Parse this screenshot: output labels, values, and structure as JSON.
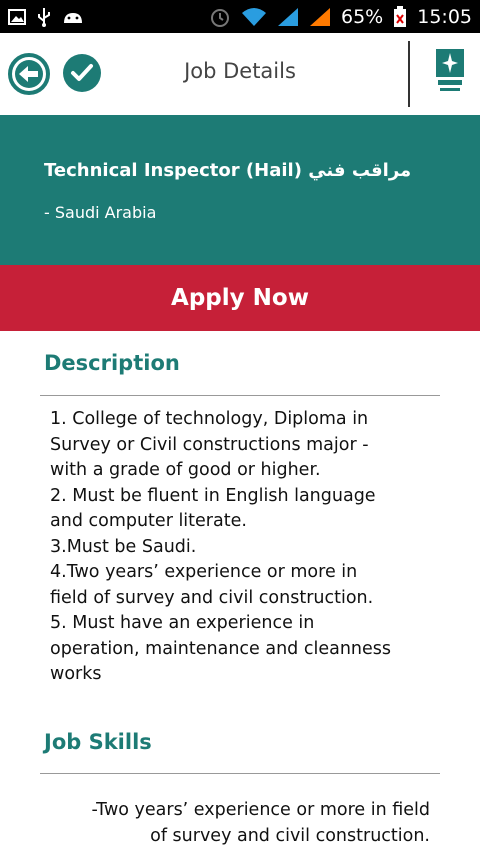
{
  "status_bar": {
    "battery": "65%",
    "time": "15:05",
    "icons_left": [
      "image-icon",
      "usb-icon",
      "android-icon"
    ],
    "icons_right": [
      "alarm-icon",
      "wifi-icon",
      "signal-icon",
      "signal-2-icon",
      "battery-icon"
    ]
  },
  "app_bar": {
    "title": "Job Details"
  },
  "job": {
    "title": "Technical Inspector  (Hail)  مراقب فني",
    "location": "- Saudi Arabia"
  },
  "apply_label": "Apply Now",
  "description": {
    "heading": "Description",
    "lines": [
      "1. College of technology, Diploma in",
      "Survey or Civil constructions major -",
      "with a grade of good or higher.",
      "2. Must be fluent in English language",
      "and computer literate.",
      "3.Must be Saudi.",
      "4.Two years’ experience or more in",
      "field of survey and civil construction.",
      "5. Must have an experience in",
      "operation, maintenance and cleanness",
      "works"
    ]
  },
  "skills": {
    "heading": "Job Skills",
    "lines": [
      "-Two years’ experience or more in field",
      "of survey and civil construction."
    ]
  },
  "colors": {
    "teal": "#1d7b75",
    "red": "#c62038",
    "status_bg": "#000000"
  }
}
